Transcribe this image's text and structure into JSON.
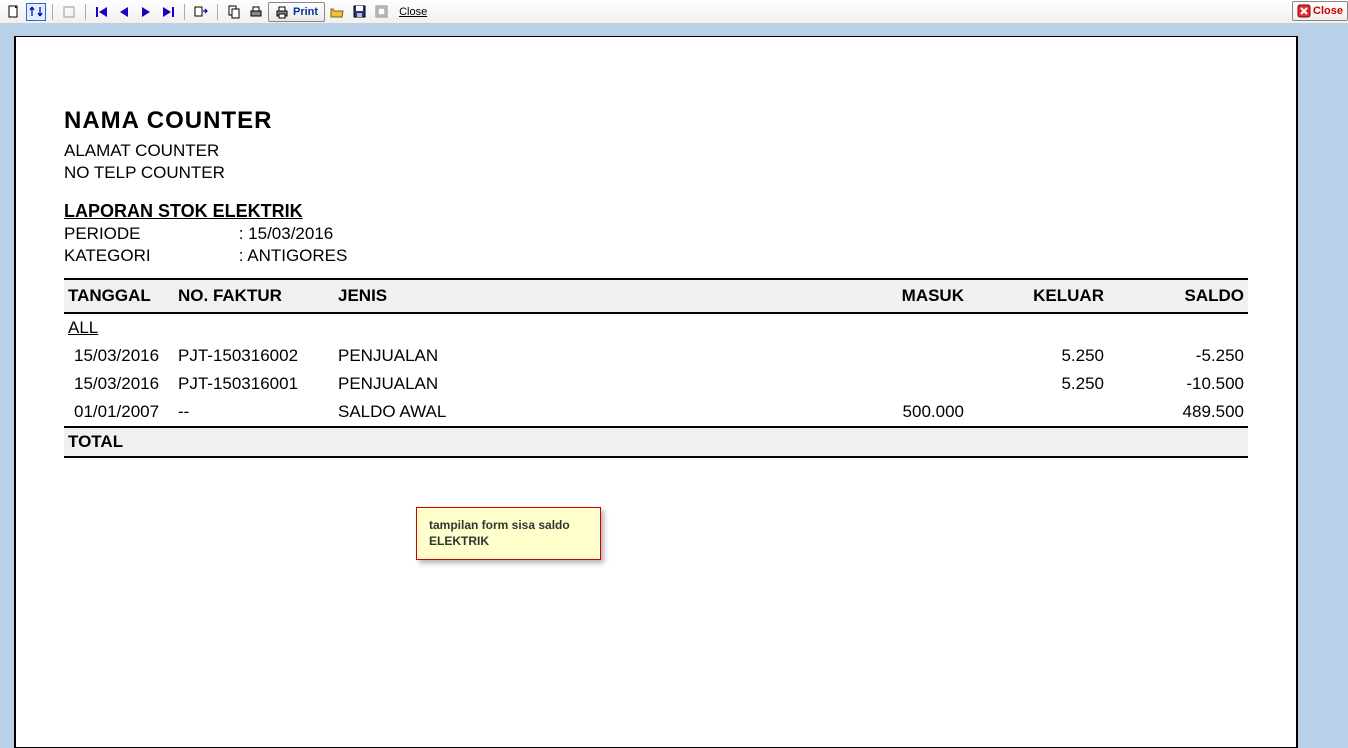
{
  "toolbar": {
    "print_label": "Print",
    "close_link": "Close",
    "close_button": "Close"
  },
  "report": {
    "title": "NAMA COUNTER",
    "address": "ALAMAT COUNTER",
    "phone": "NO TELP COUNTER",
    "section_title": "LAPORAN STOK ELEKTRIK",
    "period_label": "PERIODE",
    "period_value": "15/03/2016",
    "category_label": "KATEGORI",
    "category_value": "ANTIGORES",
    "columns": {
      "tanggal": "TANGGAL",
      "no_faktur": "NO. FAKTUR",
      "jenis": "JENIS",
      "masuk": "MASUK",
      "keluar": "KELUAR",
      "saldo": "SALDO"
    },
    "group_label": "ALL",
    "rows": [
      {
        "tanggal": "15/03/2016",
        "no_faktur": "PJT-150316002",
        "jenis": "PENJUALAN",
        "masuk": "",
        "keluar": "5.250",
        "saldo": "-5.250"
      },
      {
        "tanggal": "15/03/2016",
        "no_faktur": "PJT-150316001",
        "jenis": "PENJUALAN",
        "masuk": "",
        "keluar": "5.250",
        "saldo": "-10.500"
      },
      {
        "tanggal": "01/01/2007",
        "no_faktur": "--",
        "jenis": "SALDO AWAL",
        "masuk": "500.000",
        "keluar": "",
        "saldo": "489.500"
      }
    ],
    "total_label": "TOTAL"
  },
  "annotation": {
    "text": "tampilan form sisa saldo ELEKTRIK"
  }
}
